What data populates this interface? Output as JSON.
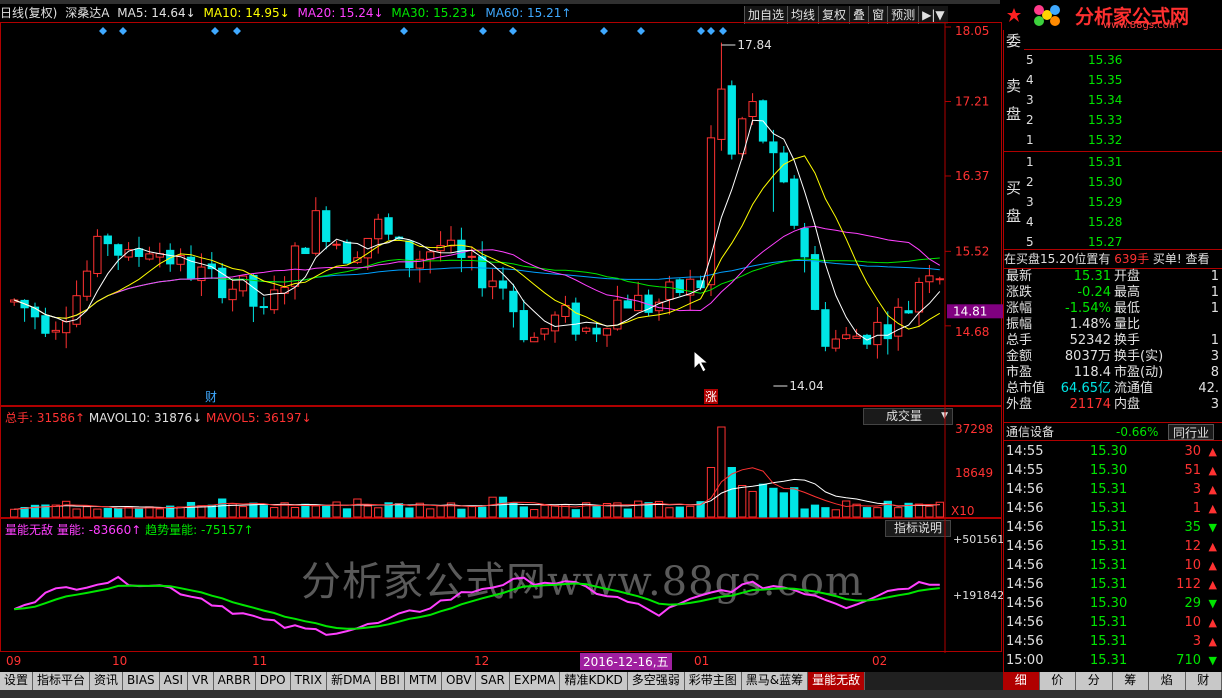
{
  "header": {
    "period": "日线(复权)",
    "stock": "深桑达A",
    "ma5": "MA5: 14.64↓",
    "ma10": "MA10: 14.95↓",
    "ma20": "MA20: 15.24↓",
    "ma30": "MA30: 15.23↓",
    "ma60": "MA60: 15.21↑"
  },
  "toolbar": {
    "buttons": [
      "加自选",
      "均线",
      "复权",
      "叠",
      "窗",
      "预测",
      "▶|▼"
    ]
  },
  "logo": {
    "title": "分析家公式网",
    "url": "www.88gs.com"
  },
  "main_chart": {
    "price_ticks": [
      "18.05",
      "17.21",
      "16.37",
      "15.52",
      "14.81",
      "14.68"
    ],
    "high_label": "17.84",
    "low_label": "14.04",
    "event_fin": "财",
    "event_zhang": "涨",
    "current_price": "14.81"
  },
  "volume_panel": {
    "total": "总手: 31586↑",
    "mavol10": "MAVOL10: 31876↓",
    "mavol5": "MAVOL5: 36197↓",
    "selector": "成交量",
    "ticks": [
      "37298",
      "18649"
    ],
    "unit": "X10"
  },
  "indicator_panel": {
    "name": "量能无敌",
    "qn": "量能: -83660↑",
    "trend": "趋势量能: -75157↑",
    "help_button": "指标说明",
    "ticks": [
      "+501561",
      "+191842"
    ],
    "watermark": "分析家公式网www.88gs.com"
  },
  "x_axis": {
    "labels": [
      "09",
      "10",
      "11",
      "12",
      "01",
      "02"
    ],
    "cursor_date": "2016-12-16,五"
  },
  "order_book": {
    "title": "委",
    "sell_label": "卖 盘",
    "buy_label": "买 盘",
    "sell": [
      {
        "level": "5",
        "price": "15.36"
      },
      {
        "level": "4",
        "price": "15.35"
      },
      {
        "level": "3",
        "price": "15.34"
      },
      {
        "level": "2",
        "price": "15.33"
      },
      {
        "level": "1",
        "price": "15.32"
      }
    ],
    "buy": [
      {
        "level": "1",
        "price": "15.31"
      },
      {
        "level": "2",
        "price": "15.30"
      },
      {
        "level": "3",
        "price": "15.29"
      },
      {
        "level": "4",
        "price": "15.28"
      },
      {
        "level": "5",
        "price": "15.27"
      }
    ],
    "notice": "在买盘15.20位置有",
    "notice_qty": "639手",
    "notice_tail": "买单! 查看"
  },
  "quote": [
    {
      "l1": "最新",
      "v1": "15.31",
      "l2": "开盘",
      "v2": "1"
    },
    {
      "l1": "涨跌",
      "v1": "-0.24",
      "l2": "最高",
      "v2": "1"
    },
    {
      "l1": "涨幅",
      "v1": "-1.54%",
      "l2": "最低",
      "v2": "1"
    },
    {
      "l1": "振幅",
      "v1": "1.48%",
      "l2": "量比",
      "v2": ""
    },
    {
      "l1": "总手",
      "v1": "52342",
      "l2": "换手",
      "v2": "1"
    },
    {
      "l1": "金额",
      "v1": "8037万",
      "l2": "换手(实)",
      "v2": "3"
    },
    {
      "l1": "市盈",
      "v1": "118.4",
      "l2": "市盈(动)",
      "v2": "8"
    },
    {
      "l1": "总市值",
      "v1": "64.65亿",
      "l2": "流通值",
      "v2": "42."
    },
    {
      "l1": "外盘",
      "v1": "21174",
      "l2": "内盘",
      "v2": "3"
    }
  ],
  "sector": {
    "name": "通信设备",
    "change": "-0.66%",
    "button": "同行业"
  },
  "ticks": [
    {
      "time": "14:55",
      "price": "15.30",
      "vol": "30",
      "dir": "up"
    },
    {
      "time": "14:55",
      "price": "15.30",
      "vol": "51",
      "dir": "up"
    },
    {
      "time": "14:56",
      "price": "15.31",
      "vol": "3",
      "dir": "up"
    },
    {
      "time": "14:56",
      "price": "15.31",
      "vol": "1",
      "dir": "up"
    },
    {
      "time": "14:56",
      "price": "15.31",
      "vol": "35",
      "dir": "down"
    },
    {
      "time": "14:56",
      "price": "15.31",
      "vol": "12",
      "dir": "up"
    },
    {
      "time": "14:56",
      "price": "15.31",
      "vol": "10",
      "dir": "up"
    },
    {
      "time": "14:56",
      "price": "15.31",
      "vol": "112",
      "dir": "up"
    },
    {
      "time": "14:56",
      "price": "15.30",
      "vol": "29",
      "dir": "down"
    },
    {
      "time": "14:56",
      "price": "15.31",
      "vol": "10",
      "dir": "up"
    },
    {
      "time": "14:56",
      "price": "15.31",
      "vol": "3",
      "dir": "up"
    },
    {
      "time": "15:00",
      "price": "15.31",
      "vol": "710",
      "dir": "down"
    }
  ],
  "tabs": [
    "设置",
    "指标平台",
    "资讯",
    "BIAS",
    "ASI",
    "VR",
    "ARBR",
    "DPO",
    "TRIX",
    "新DMA",
    "BBI",
    "MTM",
    "OBV",
    "SAR",
    "EXPMA",
    "精准KDKD",
    "多空强弱",
    "彩带主图",
    "黑马&蓝筹",
    "量能无敌"
  ],
  "active_tab": "量能无敌",
  "right_tabs": [
    "细",
    "价",
    "分",
    "筹",
    "焰",
    "财"
  ],
  "colors": {
    "up": "#ff3232",
    "down": "#00e6e6",
    "border": "#b00000",
    "ma5": "#ffffff",
    "ma10": "#ffff00",
    "ma20": "#ff40ff",
    "ma30": "#00e600",
    "ma60": "#00a0ff"
  }
}
